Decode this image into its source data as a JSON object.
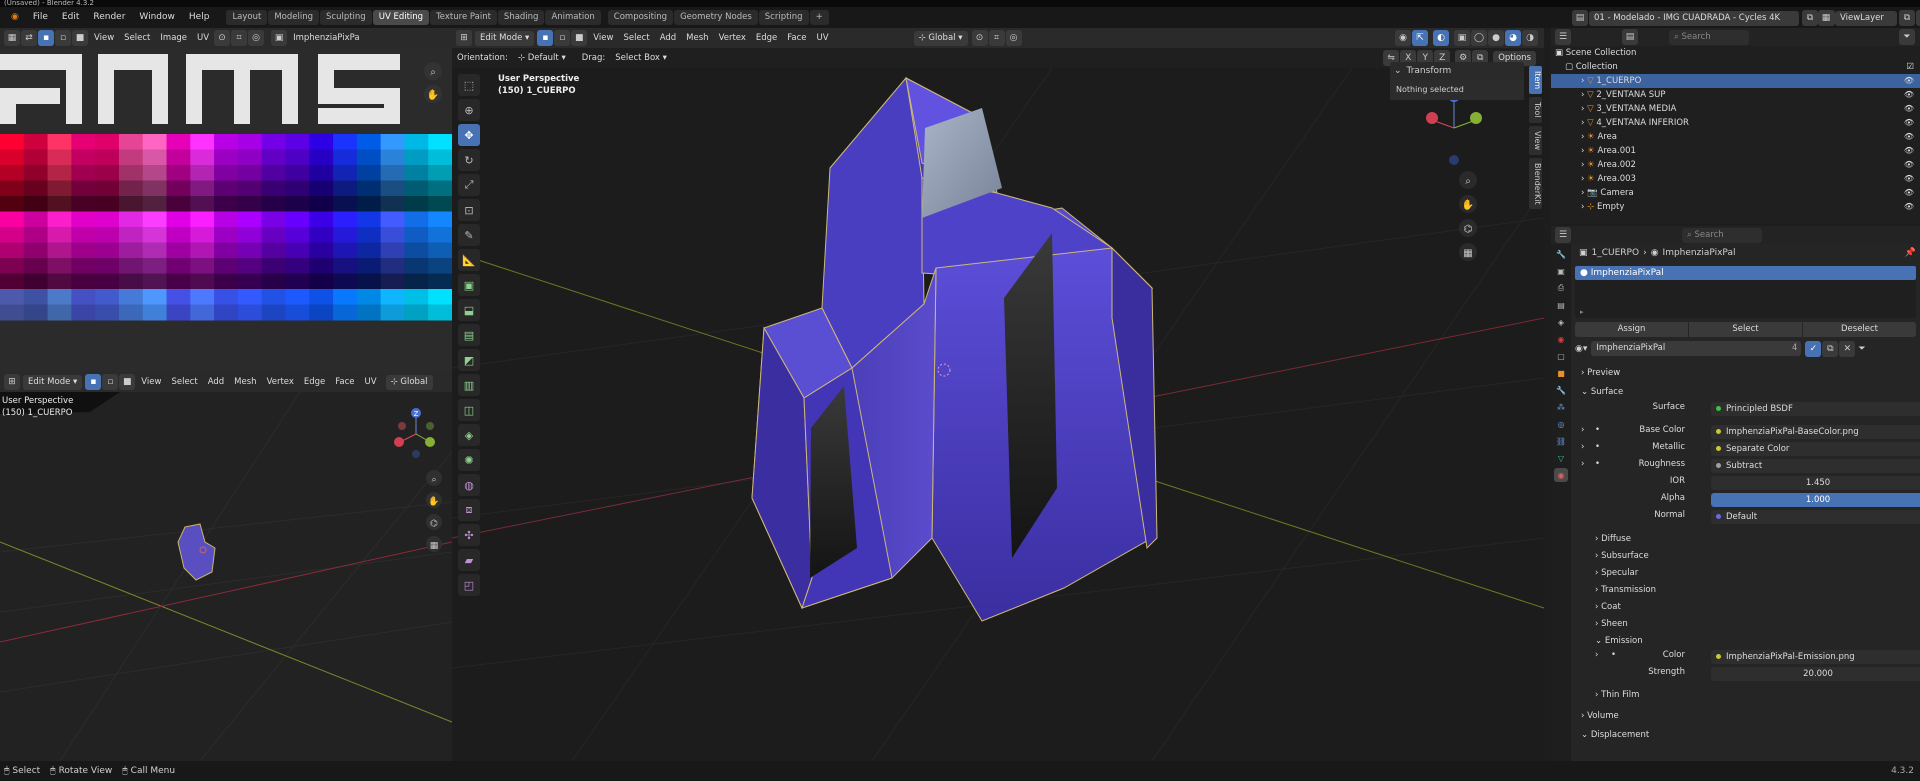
{
  "title_bar": "(Unsaved) - Blender 4.3.2",
  "menus": [
    "File",
    "Edit",
    "Render",
    "Window",
    "Help"
  ],
  "workspaces": [
    "Layout",
    "Modeling",
    "Sculpting",
    "UV Editing",
    "Texture Paint",
    "Shading",
    "Animation",
    "Compositing",
    "Geometry Nodes",
    "Scripting"
  ],
  "active_workspace": "UV Editing",
  "add_tab": "+",
  "top_right": {
    "scene_number": "01",
    "scene": "01 - Modelado - IMG CUADRADA - Cycles 4K",
    "view_layer": "ViewLayer"
  },
  "uv_editor": {
    "menus": [
      "View",
      "Select",
      "Image",
      "UV"
    ],
    "image_name": "ImphenziaPixPa",
    "palette_colors": [
      "#ff0033",
      "#e60045",
      "#ff3366",
      "#ff0080",
      "#e0006a",
      "#ff4da6",
      "#ff66c4",
      "#ff00cc",
      "#ff33ff",
      "#cc00ff",
      "#a600e6",
      "#8000ff",
      "#5c00e6",
      "#3300ff",
      "#1a33ff",
      "#0066ff",
      "#3399ff",
      "#00ccff",
      "#00e0ff"
    ]
  },
  "lower_3d": {
    "mode": "Edit Mode",
    "menus": [
      "View",
      "Select",
      "Add",
      "Mesh",
      "Vertex",
      "Edge",
      "Face",
      "UV"
    ],
    "orientation": "Global",
    "perspective": "User Perspective",
    "object": "(150) 1_CUERPO"
  },
  "viewport": {
    "mode": "Edit Mode",
    "menus": [
      "View",
      "Select",
      "Add",
      "Mesh",
      "Vertex",
      "Edge",
      "Face",
      "UV"
    ],
    "transform_orientation": "Global",
    "orientation_label": "Orientation:",
    "orientation_value": "Default",
    "drag_label": "Drag:",
    "drag_value": "Select Box",
    "options": "Options",
    "axis_labels": [
      "X",
      "Y",
      "Z"
    ],
    "perspective": "User Perspective",
    "object": "(150) 1_CUERPO",
    "n_panel_tabs": [
      "Item",
      "Tool",
      "View",
      "BlenderKit"
    ],
    "transform_title": "Transform",
    "nothing_selected": "Nothing selected"
  },
  "outliner": {
    "search_placeholder": "Search",
    "scene_collection": "Scene Collection",
    "collection": "Collection",
    "items": [
      {
        "name": "1_CUERPO",
        "type": "mesh",
        "selected": true
      },
      {
        "name": "2_VENTANA SUP",
        "type": "mesh",
        "selected": false
      },
      {
        "name": "3_VENTANA MEDIA",
        "type": "mesh",
        "selected": false
      },
      {
        "name": "4_VENTANA INFERIOR",
        "type": "mesh",
        "selected": false
      },
      {
        "name": "Area",
        "type": "light",
        "selected": false
      },
      {
        "name": "Area.001",
        "type": "light",
        "selected": false
      },
      {
        "name": "Area.002",
        "type": "light",
        "selected": false
      },
      {
        "name": "Area.003",
        "type": "light",
        "selected": false
      },
      {
        "name": "Camera",
        "type": "camera",
        "selected": false
      },
      {
        "name": "Empty",
        "type": "empty",
        "selected": false
      }
    ]
  },
  "properties": {
    "search_placeholder": "Search",
    "breadcrumb_object": "1_CUERPO",
    "breadcrumb_material": "ImphenziaPixPal",
    "slot_name": "ImphenziaPixPal",
    "assign": "Assign",
    "select": "Select",
    "deselect": "Deselect",
    "material_name": "ImphenziaPixPal",
    "user_count": "4",
    "sections": {
      "preview": "Preview",
      "surface": "Surface",
      "volume": "Volume",
      "displacement": "Displacement"
    },
    "surface_label": "Surface",
    "surface_value": "Principled BSDF",
    "rows": [
      {
        "label": "Base Color",
        "value": "ImphenziaPixPal-BaseColor.png",
        "dot": "#c8c832"
      },
      {
        "label": "Metallic",
        "value": "Separate Color",
        "dot": "#c8c832"
      },
      {
        "label": "Roughness",
        "value": "Subtract",
        "dot": "#a0a0a0"
      }
    ],
    "ior_label": "IOR",
    "ior_value": "1.450",
    "alpha_label": "Alpha",
    "alpha_value": "1.000",
    "normal_label": "Normal",
    "normal_value": "Default",
    "subsections": [
      "Diffuse",
      "Subsurface",
      "Specular",
      "Transmission",
      "Coat",
      "Sheen"
    ],
    "emission": "Emission",
    "emission_color_label": "Color",
    "emission_color_value": "ImphenziaPixPal-Emission.png",
    "strength_label": "Strength",
    "strength_value": "20.000",
    "thin_film": "Thin Film"
  },
  "status_bar": {
    "select": "Select",
    "rotate": "Rotate View",
    "call_menu": "Call Menu",
    "version": "4.3.2"
  }
}
